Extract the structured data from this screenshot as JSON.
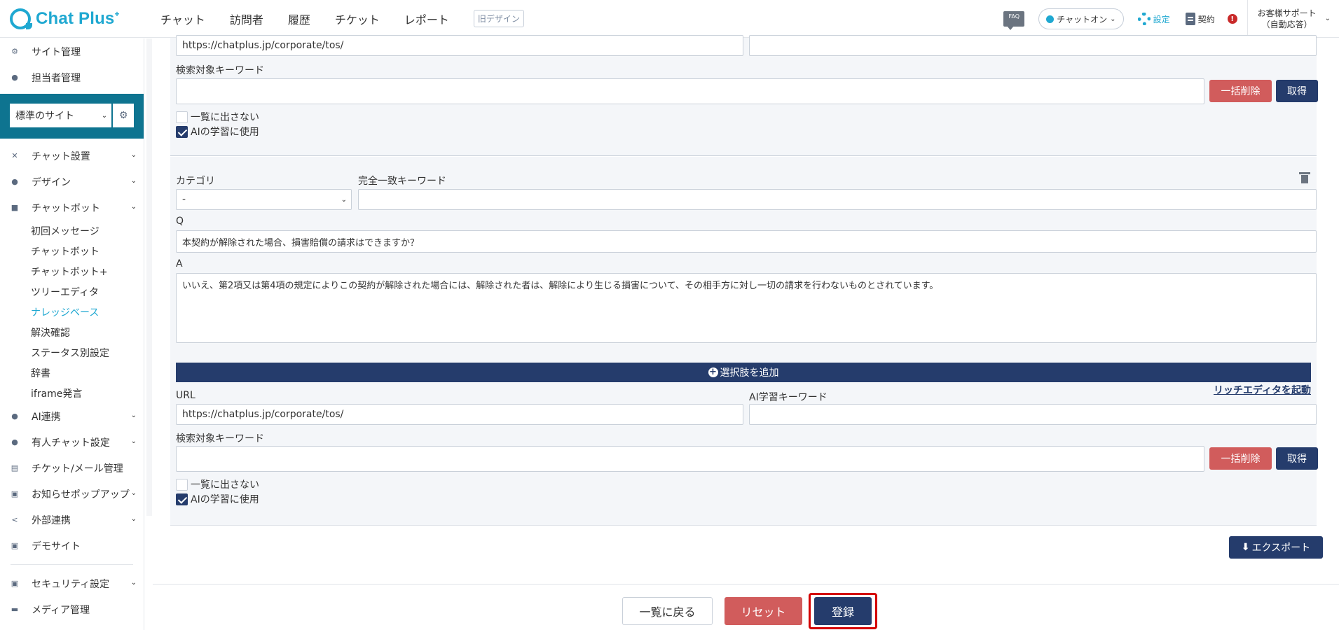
{
  "header": {
    "logo_text": "Chat Plus",
    "logo_sup": "+",
    "nav": [
      "チャット",
      "訪問者",
      "履歴",
      "チケット",
      "レポート"
    ],
    "old_design": "旧デザイン",
    "faq": "FAQ",
    "chat_status": "チャットオン",
    "settings": "設定",
    "contract": "契約",
    "alert": "!",
    "support_line1": "お客様サポート",
    "support_line2": "（自動応答）"
  },
  "sidebar": {
    "top_items": [
      "サイト管理",
      "担当者管理"
    ],
    "site_select": "標準のサイト",
    "items": [
      {
        "label": "チャット設置",
        "chevron": true
      },
      {
        "label": "デザイン",
        "chevron": true
      },
      {
        "label": "チャットボット",
        "chevron": true
      }
    ],
    "sub_items": [
      "初回メッセージ",
      "チャットボット",
      "チャットボット+",
      "ツリーエディタ",
      "ナレッジベース",
      "解決確認",
      "ステータス別設定",
      "辞書",
      "iframe発言"
    ],
    "active_sub": "ナレッジベース",
    "items2": [
      {
        "label": "AI連携",
        "chevron": true
      },
      {
        "label": "有人チャット設定",
        "chevron": true
      },
      {
        "label": "チケット/メール管理",
        "chevron": false
      },
      {
        "label": "お知らせポップアップ",
        "chevron": true
      },
      {
        "label": "外部連携",
        "chevron": true
      },
      {
        "label": "デモサイト",
        "chevron": false
      }
    ],
    "items3": [
      {
        "label": "セキュリティ設定",
        "chevron": true
      },
      {
        "label": "メディア管理",
        "chevron": false
      }
    ]
  },
  "entry1": {
    "url_value": "https://chatplus.jp/corporate/tos/",
    "ai_keyword_value": "",
    "search_keyword_label": "検索対象キーワード",
    "search_keyword_value": "",
    "bulk_delete": "一括削除",
    "fetch": "取得",
    "hide_from_list": "一覧に出さない",
    "use_for_ai": "AIの学習に使用"
  },
  "entry2": {
    "category_label": "カテゴリ",
    "category_value": "-",
    "exact_keyword_label": "完全一致キーワード",
    "exact_keyword_value": "",
    "q_label": "Q",
    "q_value": "本契約が解除された場合、損害賠償の請求はできますか？",
    "a_label": "A",
    "a_value": "いいえ、第2項又は第4項の規定によりこの契約が解除された場合には、解除された者は、解除により生じる損害について、その相手方に対し一切の請求を行わないものとされています。",
    "rich_editor": "リッチエディタを起動",
    "add_choice": "選択肢を追加",
    "url_label": "URL",
    "url_value": "https://chatplus.jp/corporate/tos/",
    "ai_keyword_label": "AI学習キーワード",
    "ai_keyword_value": "",
    "search_keyword_label": "検索対象キーワード",
    "search_keyword_value": "",
    "bulk_delete": "一括削除",
    "fetch": "取得",
    "hide_from_list": "一覧に出さない",
    "use_for_ai": "AIの学習に使用"
  },
  "export": "エクスポート",
  "footer": {
    "back": "一覧に戻る",
    "reset": "リセット",
    "save": "登録"
  },
  "colors": {
    "brand": "#1fa8d1",
    "navy": "#253c6c",
    "danger": "#d15c5c",
    "site_box": "#0e7490",
    "highlight": "#d40000"
  }
}
